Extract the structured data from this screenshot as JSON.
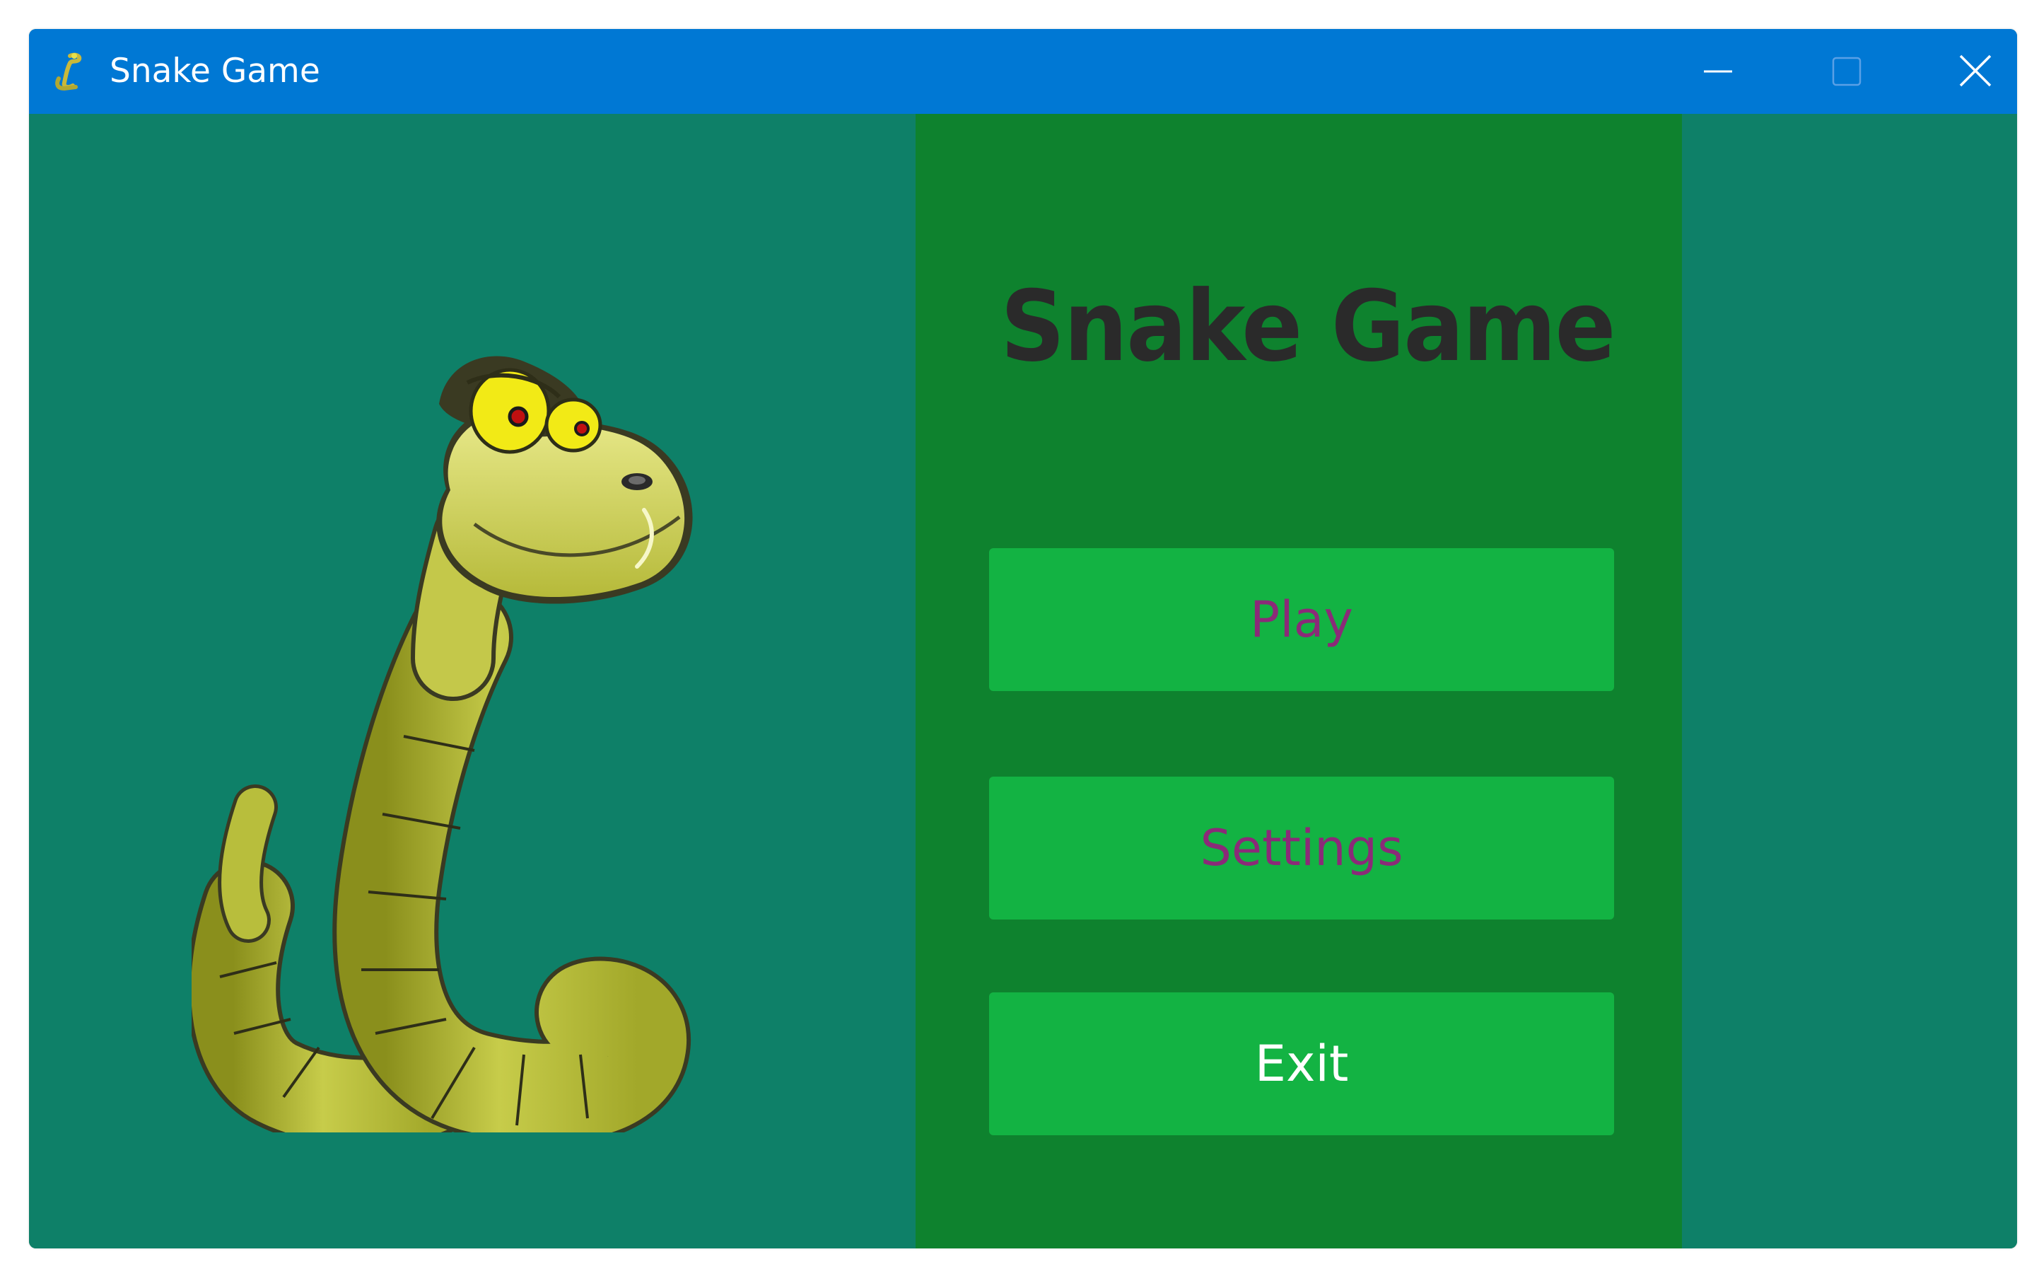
{
  "window": {
    "title": "Snake Game",
    "app_icon": "snake-icon",
    "controls": {
      "minimize_icon": "minimize-icon",
      "maximize_icon": "maximize-icon",
      "close_icon": "close-icon"
    }
  },
  "illustration": {
    "icon": "snake-illustration"
  },
  "menu": {
    "title": "Snake Game",
    "buttons": [
      {
        "label": "Play"
      },
      {
        "label": "Settings"
      },
      {
        "label": "Exit"
      }
    ]
  },
  "colors": {
    "titlebar": "#0078d4",
    "background": "#0e8068",
    "menu_panel": "#0e822e",
    "button": "#13b343",
    "button_text_purple": "#8b2a78",
    "button_text_white": "#ffffff"
  }
}
